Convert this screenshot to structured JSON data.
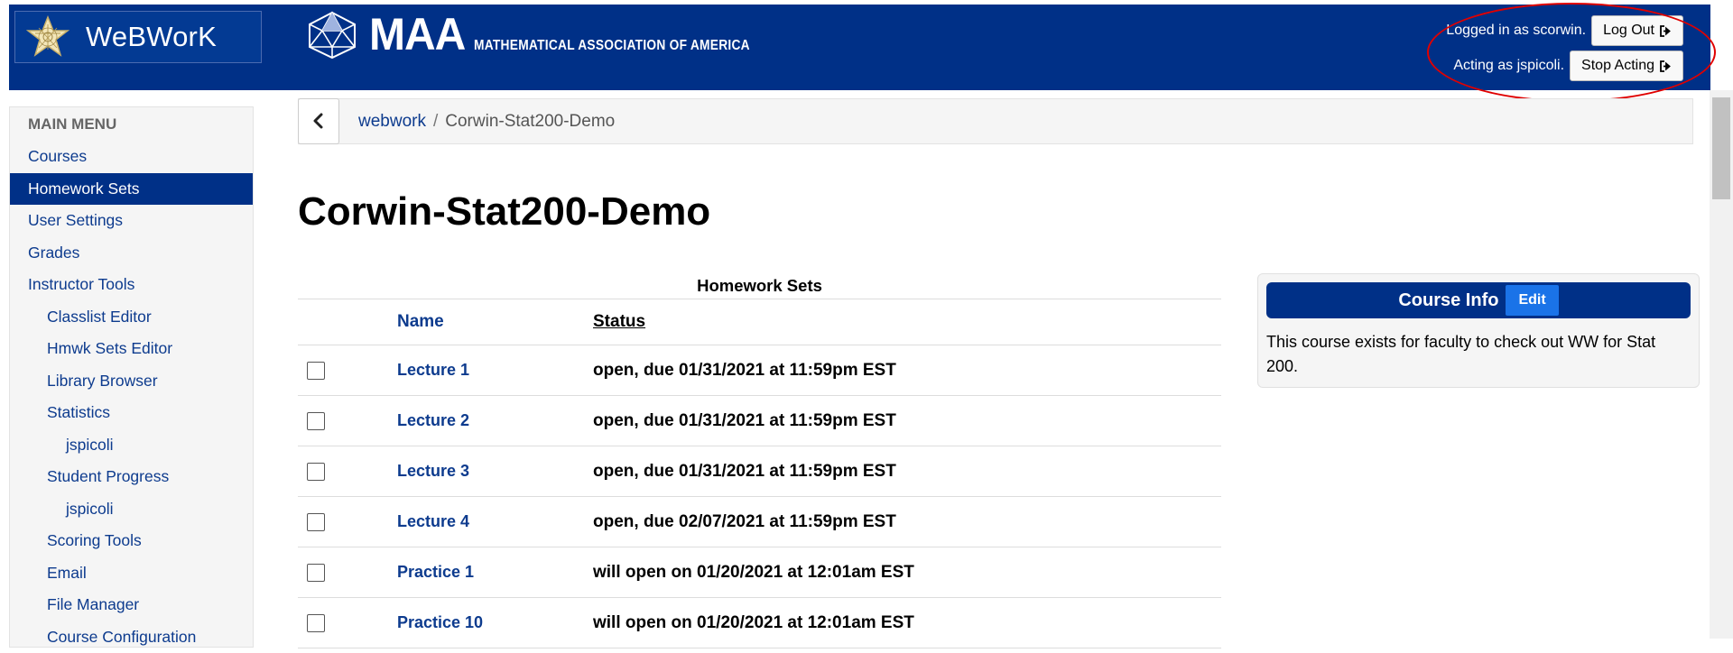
{
  "header": {
    "brand_name": "WeBWorK",
    "maa_word": "MAA",
    "maa_full": "MATHEMATICAL ASSOCIATION OF AMERICA",
    "logged_in_text": "Logged in as scorwin.",
    "logout_label": "Log Out",
    "acting_text": "Acting as jspicoli.",
    "stop_acting_label": "Stop Acting"
  },
  "sidebar": {
    "heading": "MAIN MENU",
    "items": [
      {
        "label": "Courses",
        "level": 0,
        "active": false
      },
      {
        "label": "Homework Sets",
        "level": 0,
        "active": true
      },
      {
        "label": "User Settings",
        "level": 0,
        "active": false
      },
      {
        "label": "Grades",
        "level": 0,
        "active": false
      },
      {
        "label": "Instructor Tools",
        "level": 0,
        "active": false
      },
      {
        "label": "Classlist Editor",
        "level": 1,
        "active": false
      },
      {
        "label": "Hmwk Sets Editor",
        "level": 1,
        "active": false
      },
      {
        "label": "Library Browser",
        "level": 1,
        "active": false
      },
      {
        "label": "Statistics",
        "level": 1,
        "active": false
      },
      {
        "label": "jspicoli",
        "level": 2,
        "active": false
      },
      {
        "label": "Student Progress",
        "level": 1,
        "active": false
      },
      {
        "label": "jspicoli",
        "level": 2,
        "active": false
      },
      {
        "label": "Scoring Tools",
        "level": 1,
        "active": false
      },
      {
        "label": "Email",
        "level": 1,
        "active": false
      },
      {
        "label": "File Manager",
        "level": 1,
        "active": false
      },
      {
        "label": "Course Configuration",
        "level": 1,
        "active": false
      }
    ]
  },
  "breadcrumb": {
    "root": "webwork",
    "separator": "/",
    "current": "Corwin-Stat200-Demo"
  },
  "page_title": "Corwin-Stat200-Demo",
  "table": {
    "caption": "Homework Sets",
    "columns": {
      "name": "Name",
      "status": "Status"
    },
    "rows": [
      {
        "name": "Lecture 1",
        "status": "open, due 01/31/2021 at 11:59pm EST"
      },
      {
        "name": "Lecture 2",
        "status": "open, due 01/31/2021 at 11:59pm EST"
      },
      {
        "name": "Lecture 3",
        "status": "open, due 01/31/2021 at 11:59pm EST"
      },
      {
        "name": "Lecture 4",
        "status": "open, due 02/07/2021 at 11:59pm EST"
      },
      {
        "name": "Practice 1",
        "status": "will open on 01/20/2021 at 12:01am EST"
      },
      {
        "name": "Practice 10",
        "status": "will open on 01/20/2021 at 12:01am EST"
      }
    ]
  },
  "course_info": {
    "title": "Course Info",
    "edit_label": "Edit",
    "body": "This course exists for faculty to check out WW for Stat 200."
  },
  "colors": {
    "header_bg": "#003087",
    "link": "#0d3b8e",
    "edit_button": "#1a73e8",
    "annotation_ring": "#e00000"
  }
}
